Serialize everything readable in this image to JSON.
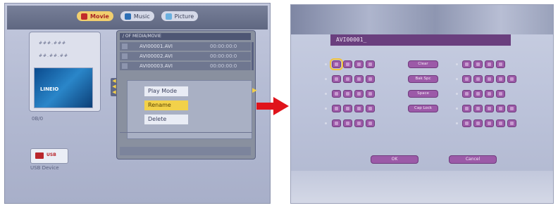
{
  "left_screen": {
    "tabs": [
      {
        "label": "Movie",
        "icon": "film-icon",
        "active": true
      },
      {
        "label": "Music",
        "icon": "music-note-icon",
        "active": false
      },
      {
        "label": "Picture",
        "icon": "picture-icon",
        "active": false
      }
    ],
    "thumbnail": {
      "line1": "###.###",
      "line2": "##.##.##",
      "preview_logo": "LINEIO"
    },
    "side_text": "0B/0",
    "usb": {
      "label": "USB",
      "caption": "USB Device"
    },
    "file_list": {
      "header": "/ OF MEDIA/MOVIE",
      "rows": [
        {
          "name": "AVI00001.AVI",
          "time": "00:00:00:0"
        },
        {
          "name": "AVI00002.AVI",
          "time": "00:00:00:0"
        },
        {
          "name": "AVI00003.AVI",
          "time": "00:00:00:0"
        }
      ]
    },
    "submenu": {
      "items": [
        {
          "label": "Play Mode",
          "selected": false
        },
        {
          "label": "Rename",
          "selected": true
        },
        {
          "label": "Delete",
          "selected": false
        }
      ]
    }
  },
  "right_screen": {
    "name_field_value": "AVI00001_",
    "function_keys": [
      "Clear",
      "Bak Spc",
      "Space",
      "Cap Lock"
    ],
    "buttons": {
      "ok": "OK",
      "cancel": "Cancel"
    }
  },
  "colors": {
    "accent_yellow": "#f2d14a",
    "key_purple": "#9c5aa8",
    "field_purple": "#6a3f7e",
    "arrow_red": "#e0141b"
  }
}
